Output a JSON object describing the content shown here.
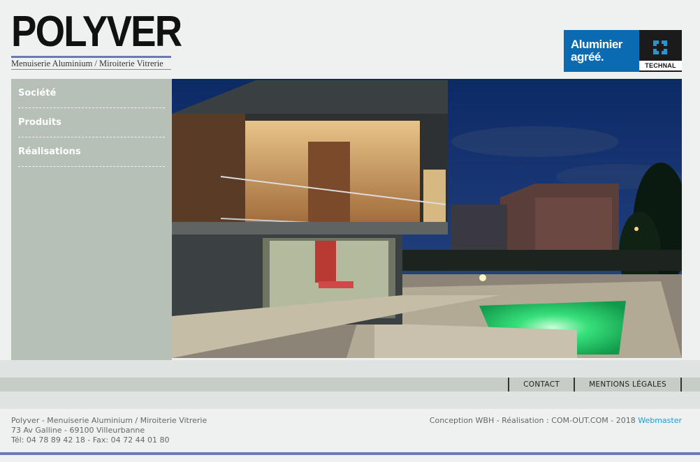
{
  "logo": {
    "name": "POLYVER",
    "tagline": "Menuiserie Aluminium / Miroiterie Vitrerie"
  },
  "badge": {
    "line1": "Aluminier",
    "line2": "agréé.",
    "brand": "TECHNAL",
    "colors": {
      "blue": "#0a6bb3",
      "dark": "#1b1b1b"
    }
  },
  "nav": {
    "items": [
      {
        "label": "Société"
      },
      {
        "label": "Produits"
      },
      {
        "label": "Réalisations"
      }
    ]
  },
  "footer_links": {
    "contact": "CONTACT",
    "legal": "MENTIONS LÉGALES"
  },
  "footer": {
    "company": "Polyver - Menuiserie Aluminium / Miroiterie Vitrerie",
    "address": "73 Av Galline - 69100 Villeurbanne",
    "phone": "Tél: 04 78 89 42 18 - Fax: 04 72 44 01 80",
    "credits": "Conception WBH - Réalisation : COM-OUT.COM - 2018",
    "webmaster": "Webmaster"
  },
  "colors": {
    "accent_rule": "#6d78b4",
    "sidebar": "#b7c0b7",
    "link": "#1a9ad6"
  }
}
